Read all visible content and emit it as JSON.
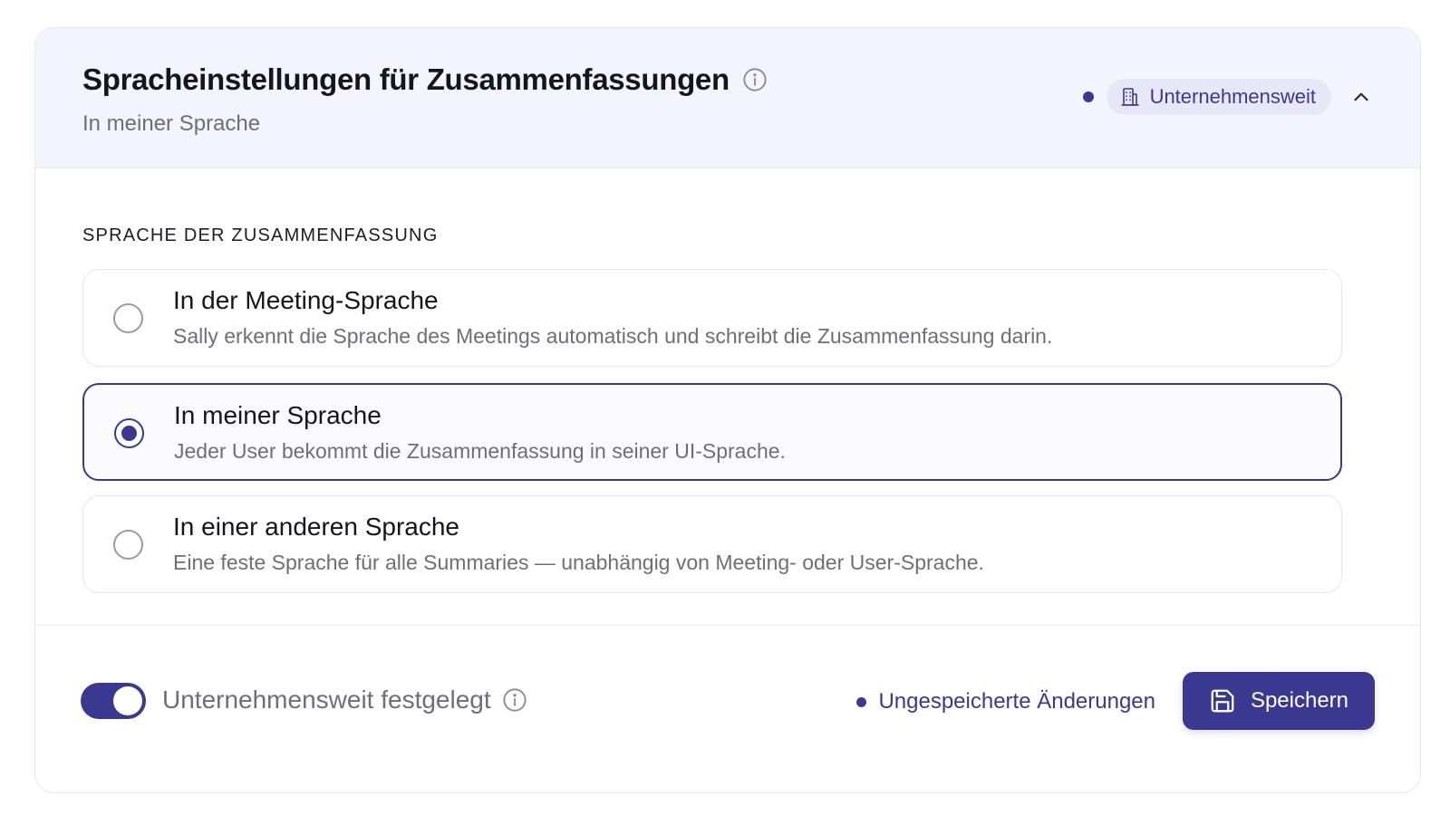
{
  "header": {
    "title": "Spracheinstellungen für Zusammenfassungen",
    "subtitle": "In meiner Sprache",
    "scope_badge": "Unternehmensweit"
  },
  "section": {
    "label": "SPRACHE DER ZUSAMMENFASSUNG"
  },
  "options": [
    {
      "title": "In der Meeting-Sprache",
      "description": "Sally erkennt die Sprache des Meetings automatisch und schreibt die Zusammenfassung darin.",
      "selected": false
    },
    {
      "title": "In meiner Sprache",
      "description": "Jeder User bekommt die Zusammenfassung in seiner UI-Sprache.",
      "selected": true
    },
    {
      "title": "In einer anderen Sprache",
      "description": "Eine feste Sprache für alle Summaries — unabhängig von Meeting- oder User-Sprache.",
      "selected": false
    }
  ],
  "footer": {
    "toggle_label": "Unternehmensweit festgelegt",
    "toggle_on": true,
    "unsaved_text": "Ungespeicherte Änderungen",
    "save_label": "Speichern"
  },
  "colors": {
    "accent": "#3b3891",
    "header_bg": "#f4f4fd",
    "badge_bg": "#e8e7f8",
    "muted_text": "#6e6e7a"
  },
  "icons": {
    "title_info": "info-icon",
    "scope": "building-icon",
    "collapse": "chevron-up-icon",
    "toggle_info": "info-icon",
    "save": "floppy-disk-icon"
  }
}
